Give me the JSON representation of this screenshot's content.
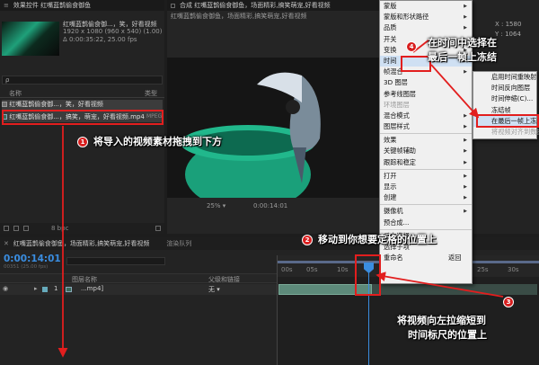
{
  "project": {
    "top_tab": "效果控件 红嘴蓝鹊偷食御鱼",
    "thumb_name": "红嘴蓝鹊偷食御...，笑，好看视频",
    "thumb_res": "1920 x 1080 (960 x 540) (1.00)",
    "thumb_dur": "Δ 0:00:35:22, 25.00 fps",
    "search_placeholder": "ρ",
    "col_name": "名称",
    "col_type": "类型",
    "items": [
      {
        "name": "红嘴蓝鹊偷食御...，笑，好看视频",
        "type": "合成"
      },
      {
        "name": "红嘴蓝鹊偷食御...，搞笑，萌宠，好看视频.mp4",
        "type": "MPEG"
      }
    ],
    "bpc": "8 bpc"
  },
  "comp": {
    "tab": "合成 红嘴蓝鹊偷食御鱼，场面精彩,搞笑萌宠,好看视频",
    "sub_tab": "红嘴蓝鹊偷食御鱼，场面精彩,搞笑萌宠,好看视频",
    "zoom": "25%",
    "time": "0:00:14:01",
    "info_x": "X : 1580",
    "info_y": "Y : 1064"
  },
  "context_menu": {
    "items": [
      {
        "label": "蒙版",
        "sub": true
      },
      {
        "label": "蒙版和形状路径",
        "sub": true
      },
      {
        "label": "品质",
        "sub": true
      },
      {
        "label": "开关",
        "sub": true
      },
      {
        "label": "变换",
        "sub": true
      },
      {
        "label": "时间",
        "sub": true,
        "highlight": true
      },
      {
        "label": "帧混合",
        "sub": true
      },
      {
        "label": "3D 图层",
        "sub": false
      },
      {
        "label": "参考线图层",
        "sub": false
      },
      {
        "label": "环境图层",
        "sub": false,
        "disabled": true
      },
      {
        "label": "混合模式",
        "sub": true
      },
      {
        "label": "图层样式",
        "sub": true
      },
      {
        "sep": true
      },
      {
        "label": "效果",
        "sub": true
      },
      {
        "label": "关键帧辅助",
        "sub": true
      },
      {
        "label": "跟踪和稳定",
        "sub": true
      },
      {
        "sep": true
      },
      {
        "label": "打开",
        "sub": true
      },
      {
        "label": "显示",
        "sub": true
      },
      {
        "label": "创建",
        "sub": true
      },
      {
        "sep": true
      },
      {
        "label": "摄像机",
        "sub": true
      },
      {
        "label": "预合成...",
        "sub": false
      },
      {
        "sep": true
      },
      {
        "label": "反向选择",
        "sub": false
      },
      {
        "label": "选择子项",
        "sub": false
      },
      {
        "label": "重命名",
        "sub": false,
        "extra": "返回"
      }
    ]
  },
  "submenu": {
    "items": [
      {
        "label": "启用时间重映射",
        "disabled": false
      },
      {
        "label": "时间反向图层",
        "disabled": false
      },
      {
        "label": "时间伸缩(C)...",
        "disabled": false
      },
      {
        "label": "冻结帧",
        "disabled": false
      },
      {
        "label": "在最后一帧上冻结",
        "highlight": true
      },
      {
        "label": "将视频对齐到数据",
        "disabled": true
      }
    ]
  },
  "timeline": {
    "tab_name": "红嘴蓝鹊偷食御鱼，场面精彩,搞笑萌宠,好看视频",
    "render_queue": "渲染队列",
    "timecode": "0:00:14:01",
    "timecode_sub": "00351 (25.00 fps)",
    "col_layer": "图层名称",
    "col_parent": "父级和链接",
    "layer_num": "1",
    "layer_name": "...mp4]",
    "parent_value": "无",
    "ruler_ticks": [
      "00s",
      "05s",
      "10s",
      "20s",
      "25s",
      "30s"
    ]
  },
  "annotations": {
    "a1": {
      "num": "1",
      "text": "将导入的视频素材拖拽到下方"
    },
    "a2": {
      "num": "2",
      "text": "移动到你想要定格的位置上"
    },
    "a3": {
      "num": "3",
      "line1": "将视频向左拉缩短到",
      "line2": "时间标尺的位置上"
    },
    "a4": {
      "num": "4",
      "line1": "在时间中选择在",
      "line2": "最后一帧上冻结"
    }
  },
  "colors": {
    "accent_red": "#e21e1e",
    "timecode_blue": "#3a8de0",
    "bar_green": "#5d8a7a"
  }
}
